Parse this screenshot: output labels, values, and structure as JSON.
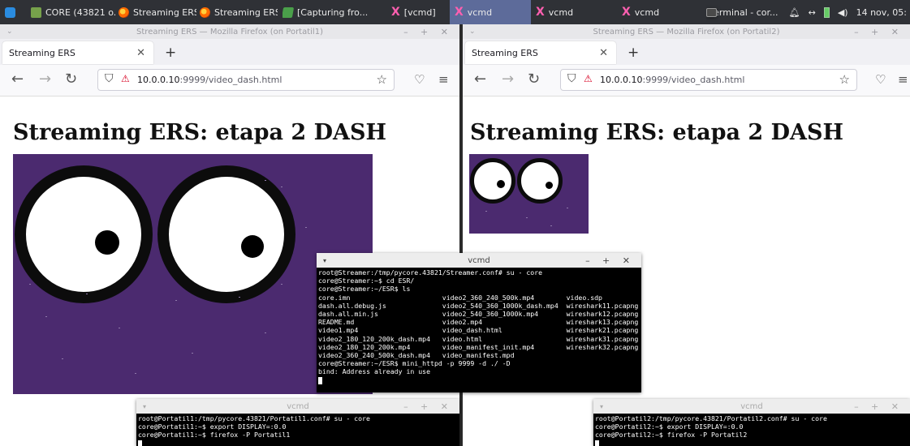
{
  "taskbar": {
    "items": [
      {
        "icon": "core-app-icon",
        "label": "CORE (43821 o..."
      },
      {
        "icon": "firefox-icon",
        "label": "Streaming ERS..."
      },
      {
        "icon": "firefox-icon",
        "label": "Streaming ERS..."
      },
      {
        "icon": "capture-icon",
        "label": "[Capturing fro..."
      },
      {
        "icon": "x-terminal-icon",
        "label": "[vcmd]"
      },
      {
        "icon": "x-terminal-icon",
        "label": "vcmd"
      },
      {
        "icon": "x-terminal-icon",
        "label": "vcmd"
      },
      {
        "icon": "x-terminal-icon",
        "label": "vcmd"
      },
      {
        "icon": "terminal-icon",
        "label": "[Terminal - cor..."
      }
    ],
    "clock": "14 nov, 05:"
  },
  "browser_left": {
    "window_title": "Streaming ERS — Mozilla Firefox (on Portatil1)",
    "tab_title": "Streaming ERS",
    "url_host": "10.0.0.10",
    "url_path": ":9999/video_dash.html",
    "heading": "Streaming ERS: etapa 2 DASH"
  },
  "browser_right": {
    "window_title": "Streaming ERS — Mozilla Firefox (on Portatil2)",
    "tab_title": "Streaming ERS",
    "url_host": "10.0.0.10",
    "url_path": ":9999/video_dash.html",
    "heading": "Streaming ERS: etapa 2 DASH"
  },
  "term_streamer": {
    "title": "vcmd",
    "lines": [
      "root@Streamer:/tmp/pycore.43821/Streamer.conf# su - core",
      "core@Streamer:~$ cd ESR/",
      "core@Streamer:~/ESR$ ls",
      "core.imn                       video2_360_240_500k.mp4        video.sdp",
      "dash.all.debug.js              video2_540_360_1000k_dash.mp4  wireshark11.pcapng",
      "dash.all.min.js                video2_540_360_1000k.mp4       wireshark12.pcapng",
      "README.md                      video2.mp4                     wireshark13.pcapng",
      "video1.mp4                     video_dash.html                wireshark21.pcapng",
      "video2_180_120_200k_dash.mp4   video.html                     wireshark31.pcapng",
      "video2_180_120_200k.mp4        video_manifest_init.mp4        wireshark32.pcapng",
      "video2_360_240_500k_dash.mp4   video_manifest.mpd",
      "core@Streamer:~/ESR$ mini_httpd -p 9999 -d ./ -D",
      "bind: Address already in use"
    ]
  },
  "term_p1": {
    "title": "vcmd",
    "lines": [
      "root@Portatil1:/tmp/pycore.43821/Portatil1.conf# su - core",
      "core@Portatil1:~$ export DISPLAY=:0.0",
      "core@Portatil1:~$ firefox -P Portatil1"
    ]
  },
  "term_p2": {
    "title": "vcmd",
    "lines": [
      "root@Portatil2:/tmp/pycore.43821/Portatil2.conf# su - core",
      "core@Portatil2:~$ export DISPLAY=:0.0",
      "core@Portatil2:~$ firefox -P Portatil2"
    ]
  },
  "colors": {
    "video_bg": "#4b2a6f",
    "taskbar_bg": "#2f3136",
    "taskbar_active": "#5d6b9a"
  }
}
